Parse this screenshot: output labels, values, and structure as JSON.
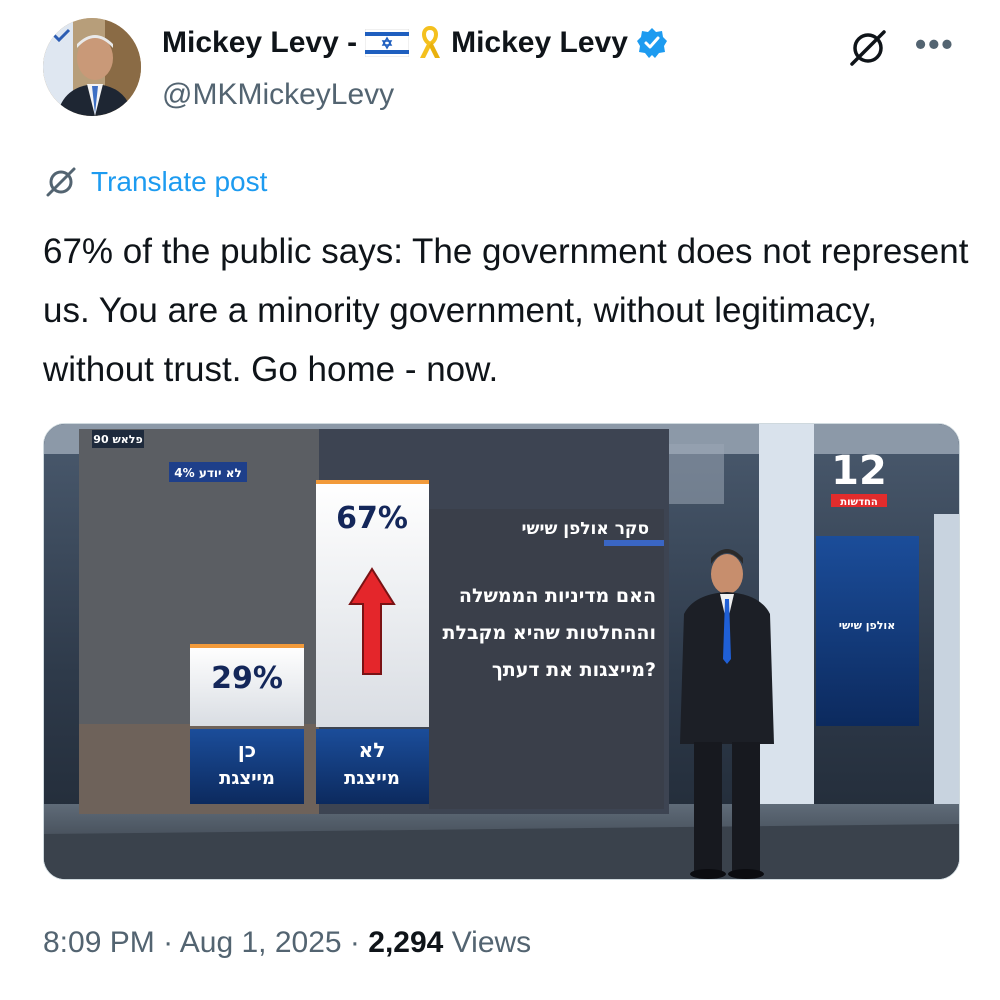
{
  "author": {
    "display_name_part1": "Mickey Levy -",
    "display_name_part2": "Mickey Levy",
    "handle": "@MKMickeyLevy",
    "flag_icon": "israel-flag-icon",
    "ribbon_icon": "yellow-ribbon-icon",
    "verified_color": "#1d9bf0"
  },
  "translate_label": "Translate post",
  "tweet_text": "67% of the public says: The government does not represent us. You are a minority government, without legitimacy, without trust. Go home - now.",
  "media": {
    "channel_logo": "12",
    "channel_sub": "החדשות",
    "panel_top_label": "90 פלאש",
    "dont_know_label": "4% לא יודע",
    "bar_yes_value": "29%",
    "bar_no_value": "67%",
    "bar_yes_label_line1": "כן",
    "bar_yes_label_line2": "מייצגת",
    "bar_no_label_line1": "לא",
    "bar_no_label_line2": "מייצגת",
    "survey_title": "סקר אולפן שישי",
    "question_line1": "האם מדיניות הממשלה",
    "question_line2": "וההחלטות שהיא מקבלת",
    "question_line3": "מייצגות את דעתך?",
    "screen_label": "אולפן שישי"
  },
  "footer": {
    "time": "8:09 PM",
    "sep1": "·",
    "date": "Aug 1, 2025",
    "sep2": "·",
    "views_count": "2,294",
    "views_label": "Views"
  }
}
